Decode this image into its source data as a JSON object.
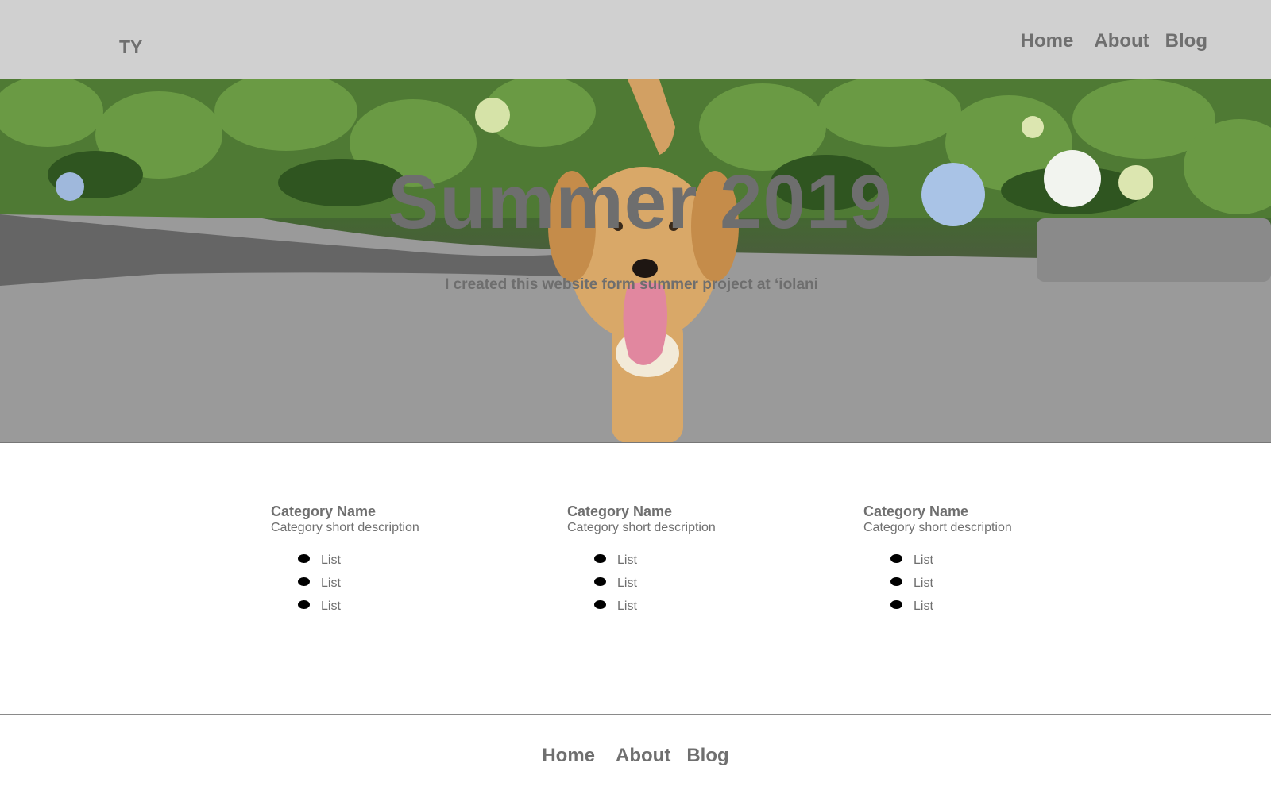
{
  "header": {
    "logo": "TY",
    "nav": [
      {
        "label": "Home"
      },
      {
        "label": "About"
      },
      {
        "label": "Blog"
      }
    ]
  },
  "hero": {
    "title": "Summer 2019",
    "subtitle": "I created this website form summer project at ‘iolani"
  },
  "categories": [
    {
      "name": "Category Name",
      "description": "Category short description",
      "items": [
        "List",
        "List",
        "List"
      ]
    },
    {
      "name": "Category Name",
      "description": "Category short description",
      "items": [
        "List",
        "List",
        "List"
      ]
    },
    {
      "name": "Category Name",
      "description": "Category short description",
      "items": [
        "List",
        "List",
        "List"
      ]
    }
  ],
  "footer": {
    "nav": [
      {
        "label": "Home"
      },
      {
        "label": "About"
      },
      {
        "label": "Blog"
      }
    ]
  },
  "colors": {
    "header_bg": "#d0d0d0",
    "text": "#6f6f6f",
    "bullet": "#000000"
  }
}
